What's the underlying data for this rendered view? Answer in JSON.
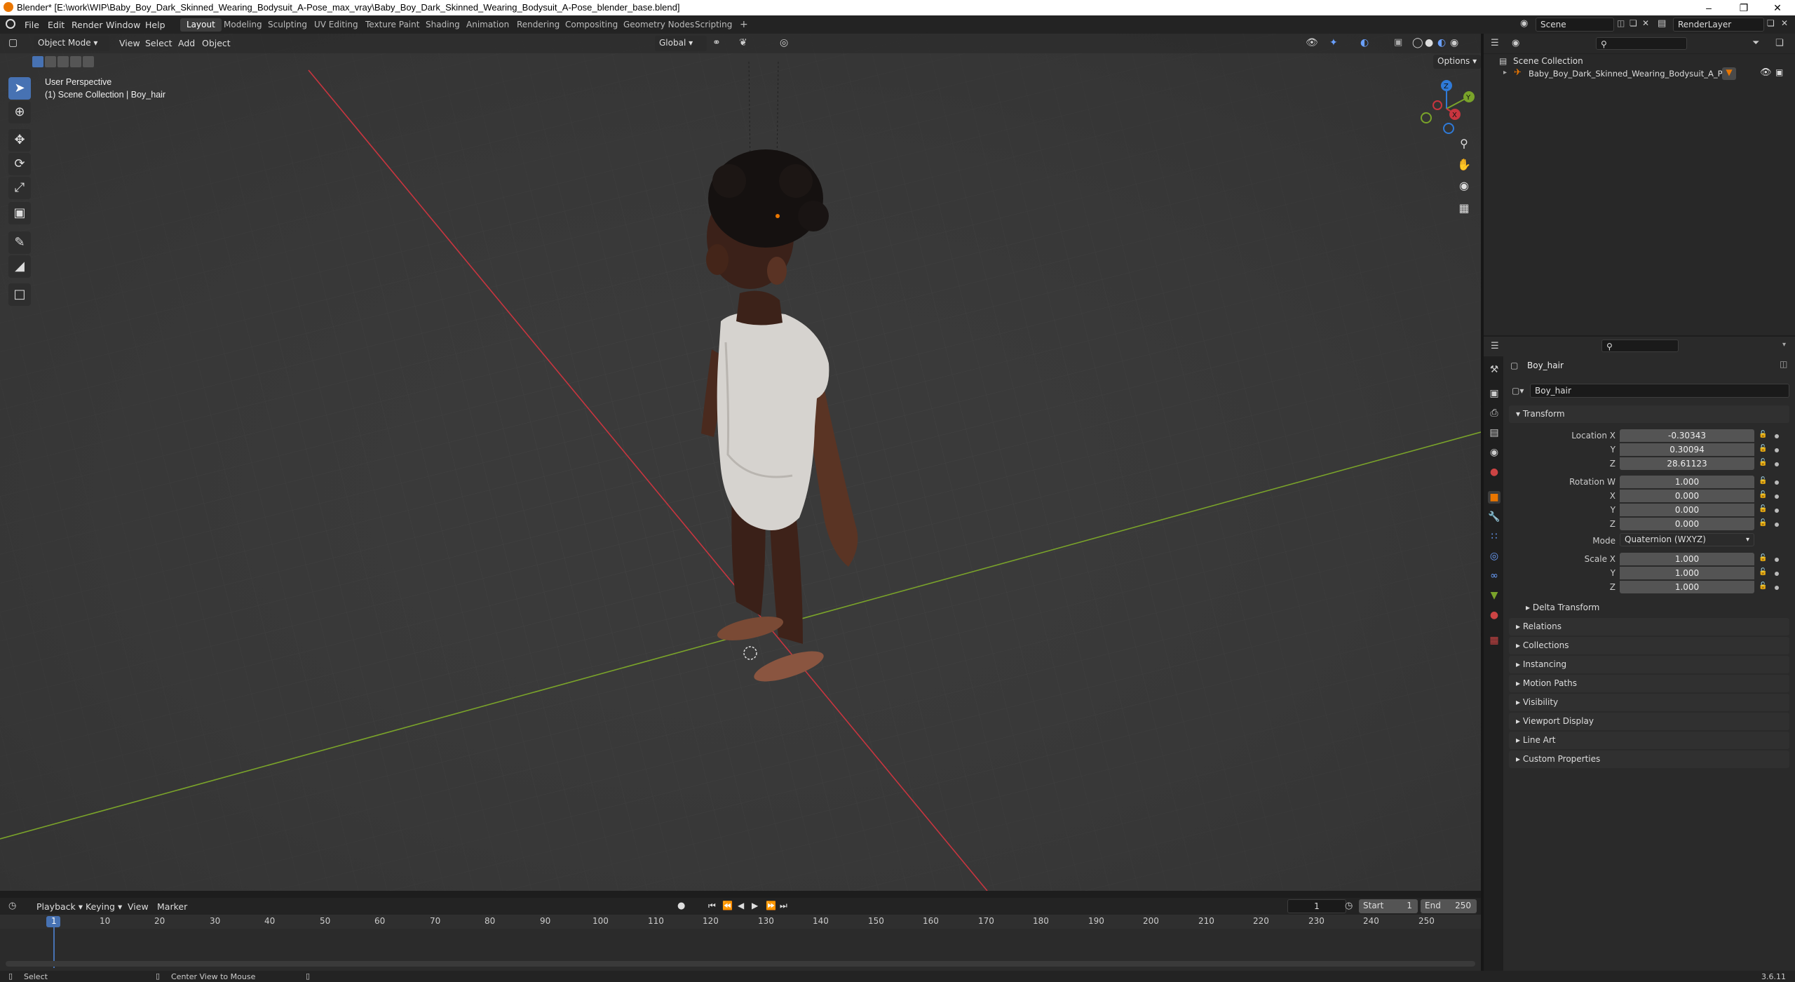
{
  "titlebar": {
    "title": "Blender* [E:\\work\\WIP\\Baby_Boy_Dark_Skinned_Wearing_Bodysuit_A-Pose_max_vray\\Baby_Boy_Dark_Skinned_Wearing_Bodysuit_A-Pose_blender_base.blend]",
    "minimize": "–",
    "maximize": "❐",
    "close": "✕"
  },
  "menus": [
    "File",
    "Edit",
    "Render",
    "Window",
    "Help"
  ],
  "workspaces": [
    "Layout",
    "Modeling",
    "Sculpting",
    "UV Editing",
    "Texture Paint",
    "Shading",
    "Animation",
    "Rendering",
    "Compositing",
    "Geometry Nodes",
    "Scripting"
  ],
  "workspace_add": "+",
  "scene": {
    "name": "Scene",
    "render_layer": "RenderLayer"
  },
  "viewport_header": {
    "mode": "Object Mode",
    "menus": [
      "View",
      "Select",
      "Add",
      "Object"
    ],
    "orientation": "Global",
    "options_label": "Options"
  },
  "viewport": {
    "perspective_label": "User Perspective",
    "collection_label": "(1) Scene Collection | Boy_hair"
  },
  "outliner": {
    "root": "Scene Collection",
    "items": [
      "Baby_Boy_Dark_Skinned_Wearing_Bodysuit_A_Pose"
    ]
  },
  "properties": {
    "object_name": "Boy_hair",
    "data_name": "Boy_hair",
    "transform_header": "Transform",
    "location_label": "Location X",
    "location": {
      "x": "-0.30343",
      "y": "0.30094",
      "z": "28.61123"
    },
    "rotation_label": "Rotation W",
    "rotation": {
      "w": "1.000",
      "x": "0.000",
      "y": "0.000",
      "z": "0.000"
    },
    "mode_label": "Mode",
    "mode_value": "Quaternion (WXYZ)",
    "scale_label": "Scale X",
    "scale": {
      "x": "1.000",
      "y": "1.000",
      "z": "1.000"
    },
    "axis_y": "Y",
    "axis_z": "Z",
    "axis_x": "X",
    "sections": [
      "Delta Transform",
      "Relations",
      "Collections",
      "Instancing",
      "Motion Paths",
      "Visibility",
      "Viewport Display",
      "Line Art",
      "Custom Properties"
    ]
  },
  "timeline": {
    "menus": [
      "Playback",
      "Keying",
      "View",
      "Marker"
    ],
    "current_frame": "1",
    "start_label": "Start",
    "start": "1",
    "end_label": "End",
    "end": "250",
    "ruler": [
      "1",
      "10",
      "20",
      "30",
      "40",
      "50",
      "60",
      "70",
      "80",
      "90",
      "100",
      "110",
      "120",
      "130",
      "140",
      "150",
      "160",
      "170",
      "180",
      "190",
      "200",
      "210",
      "220",
      "230",
      "240",
      "250"
    ]
  },
  "statusbar": {
    "select": "Select",
    "center": "Center View to Mouse",
    "version": "3.6.11"
  },
  "colors": {
    "accent": "#4772b3",
    "x_axis": "#c8353f",
    "y_axis": "#7aa32a",
    "z_axis": "#2f7ad8",
    "orange": "#ea7600"
  }
}
